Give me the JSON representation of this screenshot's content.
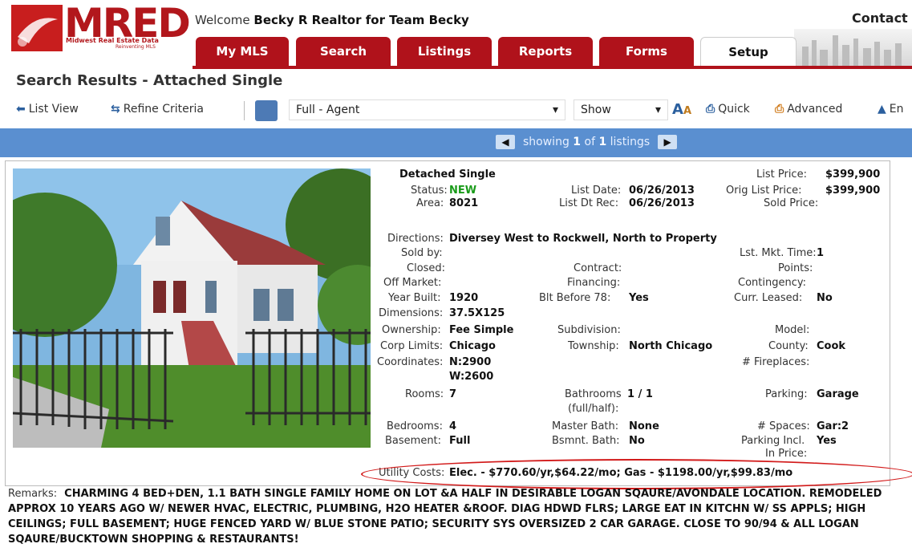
{
  "logo": {
    "text": "MRED",
    "subtitle": "Midwest Real Estate Data",
    "tagline": "Reinventing MLS"
  },
  "header": {
    "welcome_prefix": "Welcome",
    "welcome_user": "Becky R Realtor for Team Becky",
    "contact": "Contact I"
  },
  "tabs": [
    {
      "label": "My MLS"
    },
    {
      "label": "Search"
    },
    {
      "label": "Listings"
    },
    {
      "label": "Reports"
    },
    {
      "label": "Forms"
    },
    {
      "label": "Setup"
    }
  ],
  "page_title": "Search Results - Attached Single",
  "toolbar": {
    "list_view": "List View",
    "refine": "Refine Criteria",
    "view_select": "Full - Agent",
    "show_select": "Show",
    "quick": "Quick",
    "advanced": "Advanced",
    "extra": "En"
  },
  "pager": {
    "text_prefix": "showing",
    "current": "1",
    "of": "of",
    "total": "1",
    "suffix": "listings"
  },
  "listing": {
    "type": "Detached Single",
    "status_label": "Status:",
    "status": "NEW",
    "area_label": "Area:",
    "area": "8021",
    "list_date_label": "List Date:",
    "list_date": "06/26/2013",
    "list_dt_rec_label": "List Dt Rec:",
    "list_dt_rec": "06/26/2013",
    "list_price_label": "List Price:",
    "list_price": "$399,900",
    "orig_price_label": "Orig List Price:",
    "orig_price": "$399,900",
    "sold_price_label": "Sold Price:",
    "directions_label": "Directions:",
    "directions": "Diversey West to Rockwell, North to Property",
    "sold_by_label": "Sold by:",
    "mkt_time_label": "Lst. Mkt. Time:",
    "mkt_time": "1",
    "closed_label": "Closed:",
    "contract_label": "Contract:",
    "points_label": "Points:",
    "off_market_label": "Off Market:",
    "financing_label": "Financing:",
    "contingency_label": "Contingency:",
    "year_built_label": "Year Built:",
    "year_built": "1920",
    "blt78_label": "Blt Before 78:",
    "blt78": "Yes",
    "leased_label": "Curr. Leased:",
    "leased": "No",
    "dimensions_label": "Dimensions:",
    "dimensions": "37.5X125",
    "ownership_label": "Ownership:",
    "ownership": "Fee Simple",
    "subdivision_label": "Subdivision:",
    "model_label": "Model:",
    "corp_label": "Corp Limits:",
    "corp": "Chicago",
    "township_label": "Township:",
    "township": "North Chicago",
    "county_label": "County:",
    "county": "Cook",
    "coords_label": "Coordinates:",
    "coords_n": "N:2900",
    "coords_w": "W:2600",
    "fireplaces_label": "# Fireplaces:",
    "rooms_label": "Rooms:",
    "rooms": "7",
    "bath_label": "Bathrooms",
    "bath_label2": "(full/half):",
    "bath": "1 / 1",
    "parking_label": "Parking:",
    "parking": "Garage",
    "bedrooms_label": "Bedrooms:",
    "bedrooms": "4",
    "master_label": "Master Bath:",
    "master": "None",
    "spaces_label": "# Spaces:",
    "spaces": "Gar:2",
    "basement_label": "Basement:",
    "basement": "Full",
    "bsmnt_bath_label": "Bsmnt. Bath:",
    "bsmnt_bath": "No",
    "parking_incl_label": "Parking Incl.",
    "parking_incl_label2": "In Price:",
    "parking_incl": "Yes",
    "utility_label": "Utility Costs:",
    "utility": "Elec. - $770.60/yr,$64.22/mo; Gas - $1198.00/yr,$99.83/mo"
  },
  "remarks": {
    "label": "Remarks:",
    "text": "CHARMING 4 BED+DEN, 1.1 BATH SINGLE FAMILY HOME ON LOT &A HALF IN DESIRABLE LOGAN SQAURE/AVONDALE LOCATION. REMODELED APPROX 10 YEARS AGO W/ NEWER HVAC, ELECTRIC, PLUMBING, H2O HEATER &ROOF. DIAG HDWD FLRS; LARGE EAT IN KITCHN W/ SS APPLS; HIGH CEILINGS; FULL BASEMENT; HUGE FENCED YARD W/ BLUE STONE PATIO; SECURITY SYS OVERSIZED 2 CAR GARAGE. CLOSE TO 90/94 & ALL LOGAN SQAURE/BUCKTOWN SHOPPING & RESTAURANTS!"
  },
  "colors": {
    "brand_red": "#b0121b",
    "bar_blue": "#5a8fd0",
    "status_green": "#1a9b1a",
    "highlight": "#d21a1a"
  }
}
